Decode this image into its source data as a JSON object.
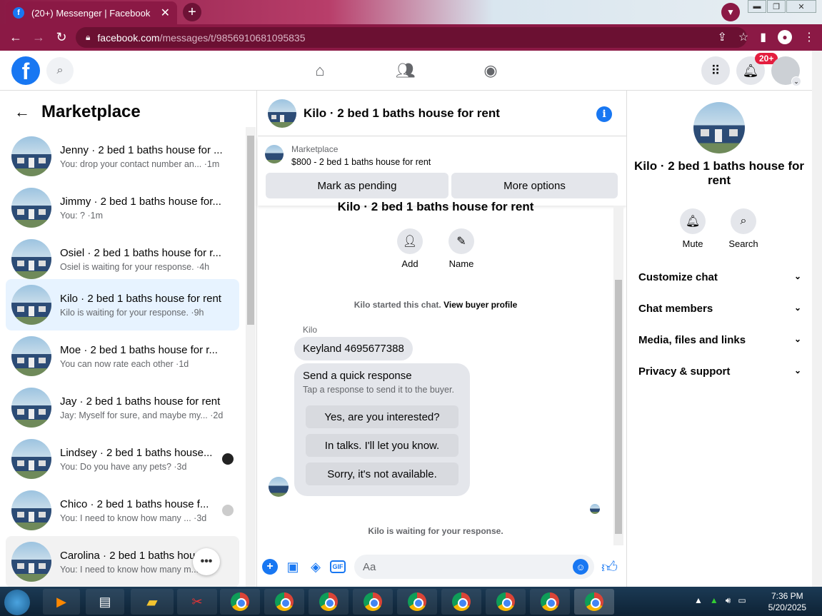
{
  "browser": {
    "tab_title": "(20+) Messenger | Facebook",
    "tab_close": "✕",
    "new_tab": "+",
    "url_host": "facebook.com",
    "url_path": "/messages/t/9856910681095835"
  },
  "fbnav": {
    "notif_badge": "20+"
  },
  "left": {
    "title": "Marketplace",
    "conversations": [
      {
        "title": "Jenny · 2 bed 1 baths house for ...",
        "sub": "You: drop your contact number an... ·1m"
      },
      {
        "title": "Jimmy · 2 bed 1 baths house for...",
        "sub": "You: ? ·1m"
      },
      {
        "title": "Osiel · 2 bed 1 baths house for r...",
        "sub": "Osiel is waiting for your response. ·4h"
      },
      {
        "title": "Kilo · 2 bed 1 baths house for rent",
        "sub": "Kilo is waiting for your response. ·9h"
      },
      {
        "title": "Moe · 2 bed 1 baths house for r...",
        "sub": "You can now rate each other ·1d"
      },
      {
        "title": "Jay · 2 bed 1 baths house for rent",
        "sub": "Jay: Myself for sure, and maybe my... ·2d"
      },
      {
        "title": "Lindsey · 2 bed 1 baths house...",
        "sub": "You: Do you have any pets? ·3d"
      },
      {
        "title": "Chico · 2 bed 1 baths house f...",
        "sub": "You: I need to know how many ... ·3d"
      },
      {
        "title": "Carolina · 2 bed 1 baths hou...",
        "sub": "You: I need to know how many m... 3d"
      }
    ]
  },
  "chat": {
    "title": "Kilo · 2 bed 1 baths house for rent",
    "listing_label": "Marketplace",
    "listing_price": "$800 - 2 bed 1 baths house for rent",
    "mark_pending": "Mark as pending",
    "more_options": "More options",
    "partial_title": "Kilo · 2 bed 1 baths house for rent",
    "add_label": "Add",
    "name_label": "Name",
    "started_text": "Kilo started this chat.",
    "view_profile": "View buyer profile",
    "sender": "Kilo",
    "message": "Keyland 4695677388",
    "quick_title": "Send a quick response",
    "quick_sub": "Tap a response to send it to the buyer.",
    "quick_replies": [
      "Yes, are you interested?",
      "In talks. I'll let you know.",
      "Sorry, it's not available."
    ],
    "waiting": "Kilo is waiting for your response.",
    "input_placeholder": "Aa",
    "gif_label": "GIF"
  },
  "right": {
    "title": "Kilo · 2 bed 1 baths house for rent",
    "mute": "Mute",
    "search": "Search",
    "sections": [
      "Customize chat",
      "Chat members",
      "Media, files and links",
      "Privacy & support"
    ]
  },
  "taskbar": {
    "time": "7:36 PM",
    "date": "5/20/2025"
  }
}
